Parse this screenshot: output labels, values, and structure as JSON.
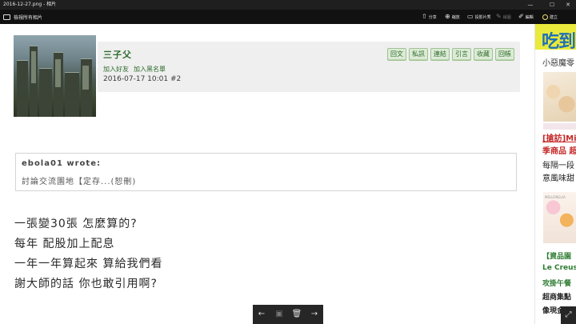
{
  "window": {
    "title": "2016-12-27.png - 相片",
    "controls": {
      "minimize": "—",
      "maximize": "☐",
      "close": "✕"
    }
  },
  "toolbar": {
    "back_label": "檢視所有相片",
    "buttons": [
      {
        "icon": "share-icon",
        "glyph": "⇧",
        "label": "分享"
      },
      {
        "icon": "zoom-icon",
        "glyph": "⊕",
        "label": "縮放"
      },
      {
        "icon": "slideshow-icon",
        "glyph": "▭",
        "label": "投影片秀"
      },
      {
        "icon": "draw-icon",
        "glyph": "✎",
        "label": "繪圖"
      },
      {
        "icon": "edit-icon",
        "glyph": "✐",
        "label": "編輯"
      },
      {
        "icon": "create-icon",
        "glyph": "◯",
        "label": "建立"
      }
    ]
  },
  "post": {
    "username": "三子父",
    "add_friend": "加入好友",
    "add_blacklist": "加入黑名單",
    "timestamp": "2016-07-17 10:01",
    "floor": "#2",
    "actions": [
      "回文",
      "私訊",
      "連結",
      "引言",
      "收藏",
      "回帳"
    ],
    "quote_author": "ebola01 wrote:",
    "quote_text": "討論交流園地【定存...(恕刪)",
    "body_lines": [
      "一張變30張 怎麼算的?",
      "每年 配股加上配息",
      "一年一年算起來 算給我們看",
      "謝大師的話 你也敢引用啊?"
    ]
  },
  "ad": {
    "banner": "吃到",
    "title": "小惡魔零",
    "red1": "[搶訪]Mi",
    "red2": "季商品 超",
    "black1": "每隔一段",
    "black2": "意風味甜",
    "green1": "【資品園",
    "green2": "Le Creus",
    "green3": "攻掛午餐",
    "black3": "超商集點",
    "black4": "像現金一",
    "img_caption": "MELLONGLIA"
  },
  "bottom_nav": {
    "prev": "←",
    "save": "▣",
    "delete": "🗑",
    "next": "→"
  },
  "expand_icon": "⤢"
}
